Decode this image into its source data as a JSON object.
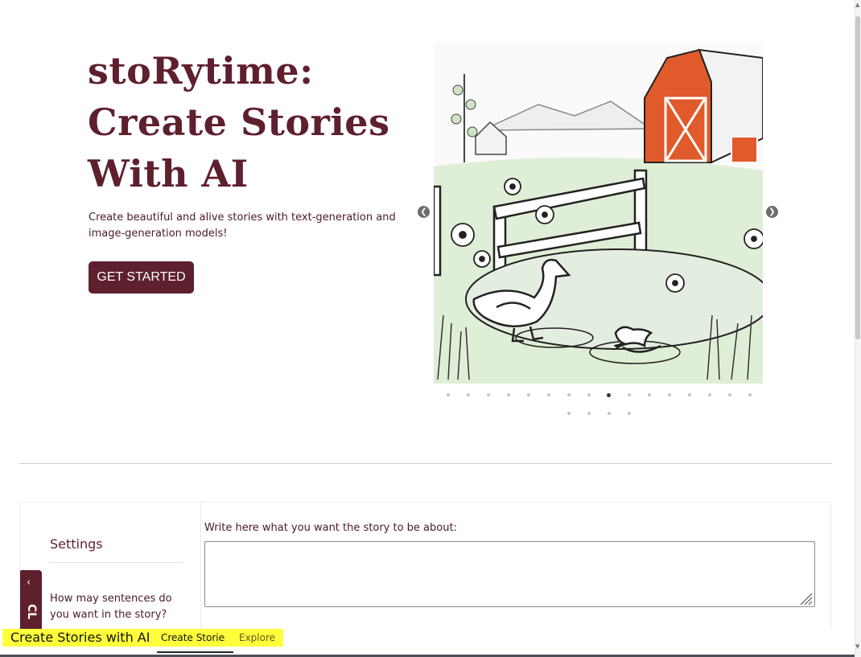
{
  "hero": {
    "title_line1": "stoRytime:",
    "title_line2": "Create Stories",
    "title_line3": "With AI",
    "description": "Create beautiful and alive stories with text-generation and image-generation models!",
    "cta_label": "GET STARTED"
  },
  "carousel": {
    "prev_icon": "chevron-left-icon",
    "next_icon": "chevron-right-icon",
    "prev_glyph": "❮",
    "next_glyph": "❯",
    "dot_count": 20,
    "active_index": 8
  },
  "settings": {
    "title": "Settings",
    "question": "How may sentences do you want in the story?",
    "collapse_glyph": "‹",
    "collapse_label": "CL"
  },
  "prompt": {
    "label": "Write here what you want the story to be about:",
    "value": ""
  },
  "tabbar": {
    "brand": "Create Stories with AI",
    "tabs": [
      {
        "label": "Create Stories",
        "active": true
      },
      {
        "label": "Explore",
        "active": false
      }
    ]
  },
  "colors": {
    "brand": "#5e1f2e",
    "highlight": "#ffff3a"
  }
}
